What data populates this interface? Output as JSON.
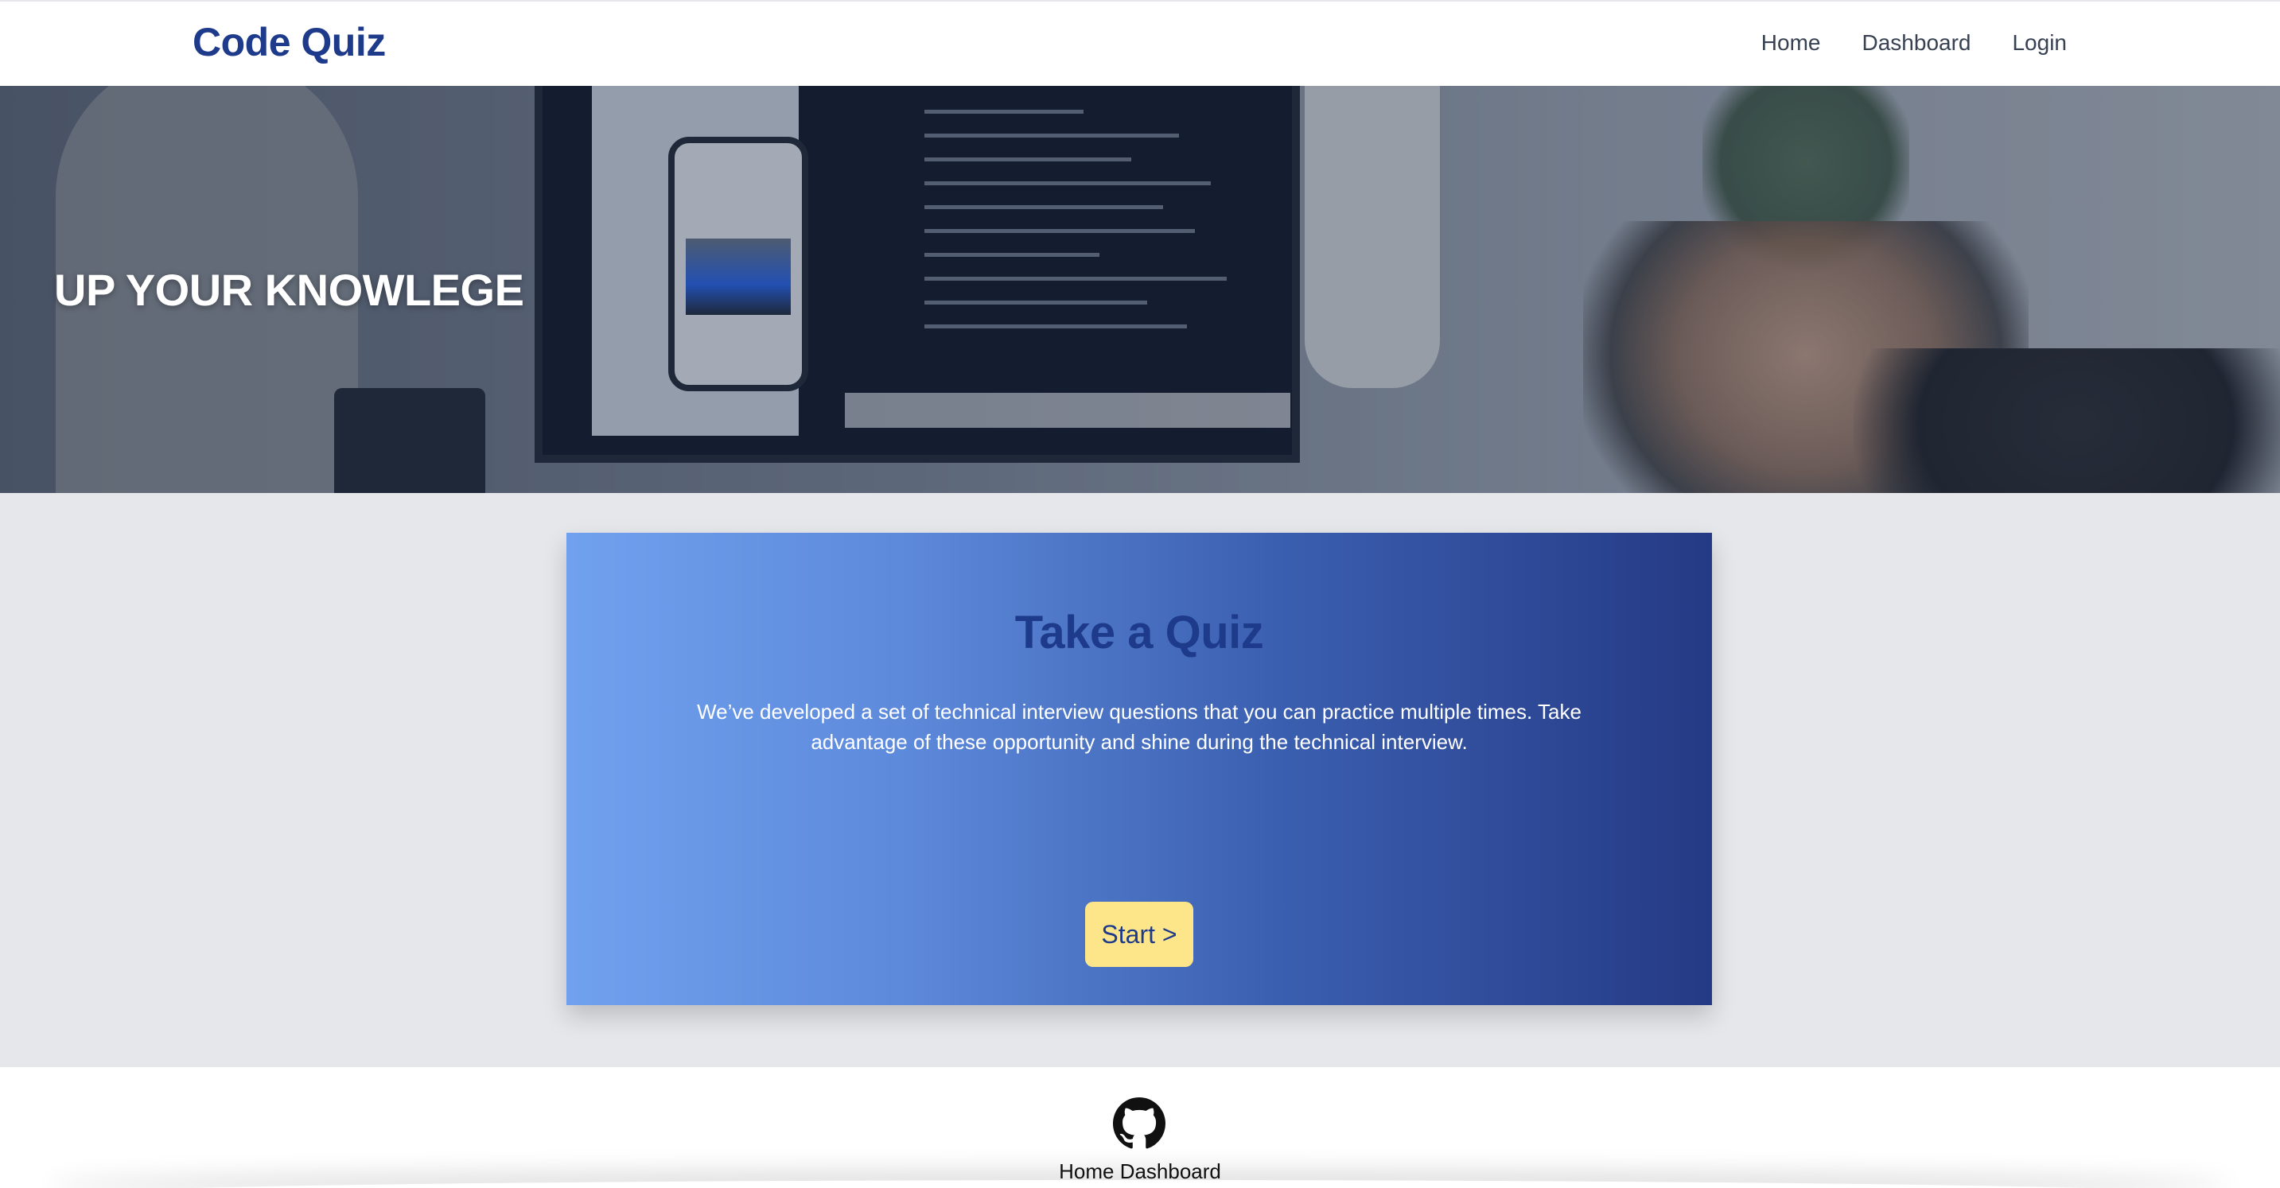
{
  "navbar": {
    "brand": "Code Quiz",
    "links": [
      "Home",
      "Dashboard",
      "Login"
    ]
  },
  "hero": {
    "title": "UP YOUR KNOWLEGE"
  },
  "quiz": {
    "title": "Take a Quiz",
    "description": "We’ve developed a set of technical interview questions that you can practice multiple times. Take advantage of these opportunity and shine during the technical interview.",
    "start_label": "Start >"
  },
  "footer": {
    "icon": "github-icon",
    "links": [
      "Home",
      "Dashboard"
    ]
  },
  "colors": {
    "brand": "#1e3a8a",
    "button": "#fde68a",
    "card_gradient_start": "#70a1ef",
    "card_gradient_end": "#253a85",
    "page_bg": "#e5e7eb"
  }
}
